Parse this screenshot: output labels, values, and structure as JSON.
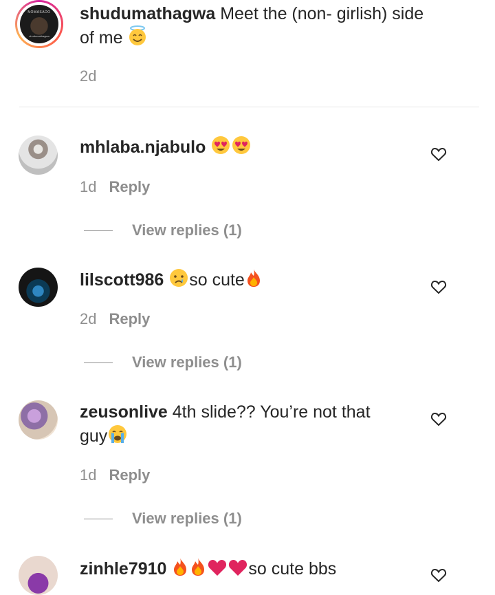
{
  "caption": {
    "username": "shudumathagwa",
    "text": "Meet the (non- girlish) side",
    "text_line2": "of me",
    "emoji_icon": "smiling-face-with-halo-emoji",
    "time": "2d",
    "avatar_text_top": "NOMASADO",
    "avatar_text_bottom": "shudumathagwa"
  },
  "comments": [
    {
      "username": "mhlaba.njabulo",
      "text": "",
      "emoji_icons": [
        "heart-eyes-emoji",
        "heart-eyes-emoji"
      ],
      "time": "1d",
      "reply_label": "Reply",
      "view_replies": "View replies (1)"
    },
    {
      "username": "lilscott986",
      "text_after_emoji": "so cute",
      "emoji_icons": [
        "crying-face-emoji",
        "fire-emoji"
      ],
      "time": "2d",
      "reply_label": "Reply",
      "view_replies": "View replies (1)"
    },
    {
      "username": "zeusonlive",
      "text": "4th slide?? You’re not that",
      "text_line2": "guy",
      "emoji_icons": [
        "loudly-crying-face-emoji"
      ],
      "time": "1d",
      "reply_label": "Reply",
      "view_replies": "View replies (1)"
    },
    {
      "username": "zinhle7910",
      "text_after_emoji": "so cute bbs",
      "emoji_icons": [
        "fire-emoji",
        "fire-emoji",
        "red-heart-emoji",
        "red-heart-emoji"
      ]
    }
  ],
  "colors": {
    "primary_text": "#262626",
    "secondary_text": "#8e8e8e",
    "divider": "#e6e6e6"
  }
}
